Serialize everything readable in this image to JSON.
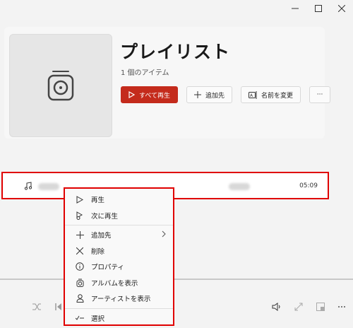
{
  "header": {
    "title": "プレイリスト",
    "item_count": "1 個のアイテム"
  },
  "actions": {
    "play_all": "すべて再生",
    "add_to": "追加先",
    "rename": "名前を変更",
    "more": "···"
  },
  "track": {
    "duration": "05:09"
  },
  "context_menu": {
    "items": [
      {
        "label": "再生",
        "icon": "play-icon"
      },
      {
        "label": "次に再生",
        "icon": "play-next-icon"
      },
      {
        "label": "追加先",
        "icon": "plus-icon",
        "submenu": true
      },
      {
        "label": "削除",
        "icon": "close-icon"
      },
      {
        "label": "プロパティ",
        "icon": "info-icon"
      },
      {
        "label": "アルバムを表示",
        "icon": "album-icon"
      },
      {
        "label": "アーティストを表示",
        "icon": "person-icon"
      },
      {
        "label": "選択",
        "icon": "select-icon"
      }
    ]
  },
  "colors": {
    "accent": "#c42b1c",
    "highlight_border": "#e00000"
  }
}
